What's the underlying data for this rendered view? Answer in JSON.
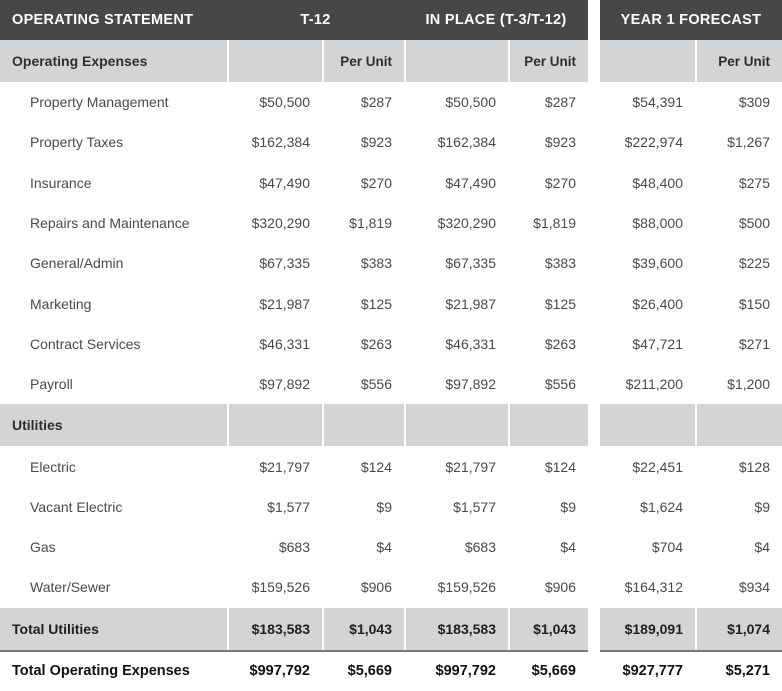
{
  "table": {
    "header": {
      "label": "OPERATING STATEMENT",
      "groups": [
        {
          "name": "t12",
          "label": "T-12"
        },
        {
          "name": "in_place",
          "label": "IN PLACE (T-3/T-12)"
        },
        {
          "name": "year1",
          "label": "YEAR 1 FORECAST"
        }
      ]
    },
    "sections": [
      {
        "title": "Operating Expenses",
        "sub_headers": {
          "t12_value": "",
          "t12_per_unit": "Per Unit",
          "in_place_value": "",
          "in_place_per_unit": "Per Unit",
          "year1_value": "",
          "year1_per_unit": "Per Unit"
        },
        "rows": [
          {
            "label": "Property Management",
            "t12": "$50,500",
            "t12_pu": "$287",
            "in_place": "$50,500",
            "in_place_pu": "$287",
            "year1": "$54,391",
            "year1_pu": "$309"
          },
          {
            "label": "Property Taxes",
            "t12": "$162,384",
            "t12_pu": "$923",
            "in_place": "$162,384",
            "in_place_pu": "$923",
            "year1": "$222,974",
            "year1_pu": "$1,267"
          },
          {
            "label": "Insurance",
            "t12": "$47,490",
            "t12_pu": "$270",
            "in_place": "$47,490",
            "in_place_pu": "$270",
            "year1": "$48,400",
            "year1_pu": "$275"
          },
          {
            "label": "Repairs and Maintenance",
            "t12": "$320,290",
            "t12_pu": "$1,819",
            "in_place": "$320,290",
            "in_place_pu": "$1,819",
            "year1": "$88,000",
            "year1_pu": "$500"
          },
          {
            "label": "General/Admin",
            "t12": "$67,335",
            "t12_pu": "$383",
            "in_place": "$67,335",
            "in_place_pu": "$383",
            "year1": "$39,600",
            "year1_pu": "$225"
          },
          {
            "label": "Marketing",
            "t12": "$21,987",
            "t12_pu": "$125",
            "in_place": "$21,987",
            "in_place_pu": "$125",
            "year1": "$26,400",
            "year1_pu": "$150"
          },
          {
            "label": "Contract Services",
            "t12": "$46,331",
            "t12_pu": "$263",
            "in_place": "$46,331",
            "in_place_pu": "$263",
            "year1": "$47,721",
            "year1_pu": "$271"
          },
          {
            "label": "Payroll",
            "t12": "$97,892",
            "t12_pu": "$556",
            "in_place": "$97,892",
            "in_place_pu": "$556",
            "year1": "$211,200",
            "year1_pu": "$1,200"
          }
        ]
      },
      {
        "title": "Utilities",
        "sub_headers": {
          "t12_value": "",
          "t12_per_unit": "",
          "in_place_value": "",
          "in_place_per_unit": "",
          "year1_value": "",
          "year1_per_unit": ""
        },
        "rows": [
          {
            "label": "Electric",
            "t12": "$21,797",
            "t12_pu": "$124",
            "in_place": "$21,797",
            "in_place_pu": "$124",
            "year1": "$22,451",
            "year1_pu": "$128"
          },
          {
            "label": "Vacant Electric",
            "t12": "$1,577",
            "t12_pu": "$9",
            "in_place": "$1,577",
            "in_place_pu": "$9",
            "year1": "$1,624",
            "year1_pu": "$9"
          },
          {
            "label": "Gas",
            "t12": "$683",
            "t12_pu": "$4",
            "in_place": "$683",
            "in_place_pu": "$4",
            "year1": "$704",
            "year1_pu": "$4"
          },
          {
            "label": "Water/Sewer",
            "t12": "$159,526",
            "t12_pu": "$906",
            "in_place": "$159,526",
            "in_place_pu": "$906",
            "year1": "$164,312",
            "year1_pu": "$934"
          }
        ]
      }
    ],
    "subtotal": {
      "label": "Total Utilities",
      "t12": "$183,583",
      "t12_pu": "$1,043",
      "in_place": "$183,583",
      "in_place_pu": "$1,043",
      "year1": "$189,091",
      "year1_pu": "$1,074"
    },
    "grand_total": {
      "label": "Total Operating Expenses",
      "t12": "$997,792",
      "t12_pu": "$5,669",
      "in_place": "$997,792",
      "in_place_pu": "$5,669",
      "year1": "$927,777",
      "year1_pu": "$5,271"
    }
  },
  "colors": {
    "header_dark": "#474747",
    "band_gray": "#d2d4d5",
    "text_dark": "#2e2e2e",
    "text_body": "#4a4a4a"
  }
}
